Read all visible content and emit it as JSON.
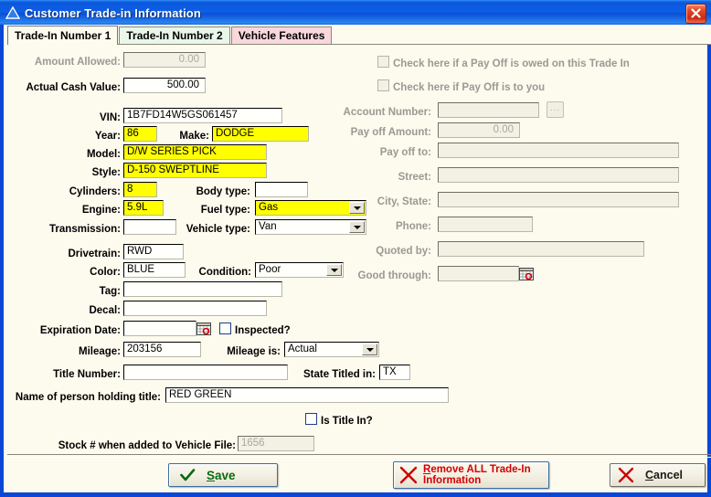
{
  "window": {
    "title": "Customer Trade-in Information",
    "icon": "triangle-icon",
    "close_icon": "close-icon",
    "border_color": "#0a46d8",
    "background": "#fdfaee"
  },
  "tabs": [
    {
      "label": "Trade-In Number 1",
      "state": "selected",
      "color": "#fdfaee"
    },
    {
      "label": "Trade-In Number 2",
      "state": "normal",
      "color": "#e9f6e9"
    },
    {
      "label": "Vehicle Features",
      "state": "normal",
      "color": "#f9d7dd"
    }
  ],
  "left": {
    "amount_allowed": {
      "label": "Amount Allowed:",
      "value": "0.00",
      "disabled": true
    },
    "actual_cash_value": {
      "label": "Actual Cash Value:",
      "value": "500.00",
      "disabled": false
    },
    "vin": {
      "label": "VIN:",
      "value": "1B7FD14W5GS061457"
    },
    "year": {
      "label": "Year:",
      "value": "86",
      "highlight": true
    },
    "make": {
      "label": "Make:",
      "value": "DODGE",
      "highlight": true
    },
    "model": {
      "label": "Model:",
      "value": "D/W SERIES PICK",
      "highlight": true
    },
    "style": {
      "label": "Style:",
      "value": "D-150 SWEPTLINE",
      "highlight": true
    },
    "cylinders": {
      "label": "Cylinders:",
      "value": "8",
      "highlight": true
    },
    "body_type": {
      "label": "Body type:",
      "value": ""
    },
    "engine": {
      "label": "Engine:",
      "value": "5.9L",
      "highlight": true
    },
    "fuel_type": {
      "label": "Fuel type:",
      "value": "Gas",
      "highlight": true
    },
    "transmission": {
      "label": "Transmission:",
      "value": ""
    },
    "vehicle_type": {
      "label": "Vehicle type:",
      "value": "Van"
    },
    "drivetrain": {
      "label": "Drivetrain:",
      "value": "RWD"
    },
    "color": {
      "label": "Color:",
      "value": "BLUE"
    },
    "condition": {
      "label": "Condition:",
      "value": "Poor"
    },
    "tag": {
      "label": "Tag:",
      "value": ""
    },
    "decal": {
      "label": "Decal:",
      "value": ""
    },
    "expiration_date": {
      "label": "Expiration Date:",
      "value": "",
      "icon": "calendar-icon"
    },
    "inspected": {
      "label": "Inspected?",
      "checked": false
    },
    "mileage": {
      "label": "Mileage:",
      "value": "203156"
    },
    "mileage_is": {
      "label": "Mileage is:",
      "value": "Actual"
    },
    "title_number": {
      "label": "Title Number:",
      "value": ""
    },
    "state_titled_in": {
      "label": "State Titled in:",
      "value": "TX"
    },
    "name_holding_title": {
      "label": "Name of person holding title:",
      "value": "RED GREEN"
    },
    "is_title_in": {
      "label": "Is Title In?",
      "checked": false
    },
    "stock_number": {
      "label": "Stock # when added to Vehicle File:",
      "value": "1656",
      "disabled": true
    }
  },
  "right": {
    "payoff_owed": {
      "label": "Check here if a Pay Off is owed on this Trade In",
      "checked": false,
      "disabled": true
    },
    "payoff_to_you": {
      "label": "Check here if Pay Off is to you",
      "checked": false,
      "disabled": true
    },
    "account_number": {
      "label": "Account Number:",
      "value": "",
      "disabled": true,
      "browse": "..."
    },
    "pay_off_amount": {
      "label": "Pay off Amount:",
      "value": "0.00",
      "disabled": true
    },
    "pay_off_to": {
      "label": "Pay off to:",
      "value": "",
      "disabled": true
    },
    "street": {
      "label": "Street:",
      "value": "",
      "disabled": true
    },
    "city_state": {
      "label": "City, State:",
      "value": "",
      "disabled": true
    },
    "phone": {
      "label": "Phone:",
      "value": "",
      "disabled": true
    },
    "quoted_by": {
      "label": "Quoted by:",
      "value": "",
      "disabled": true
    },
    "good_through": {
      "label": "Good through:",
      "value": "",
      "disabled": true,
      "icon": "calendar-icon"
    }
  },
  "buttons": {
    "save": {
      "label": "Save",
      "accel": "S",
      "icon": "check-icon",
      "color": "#0a6a12"
    },
    "remove": {
      "label_line1": "Remove ALL Trade-In",
      "label_line2": "Information",
      "accel": "R",
      "icon": "red-x-icon",
      "color": "#d40000"
    },
    "cancel": {
      "label": "Cancel",
      "accel": "C",
      "icon": "red-x-icon",
      "color": "#1a1a1a"
    }
  }
}
